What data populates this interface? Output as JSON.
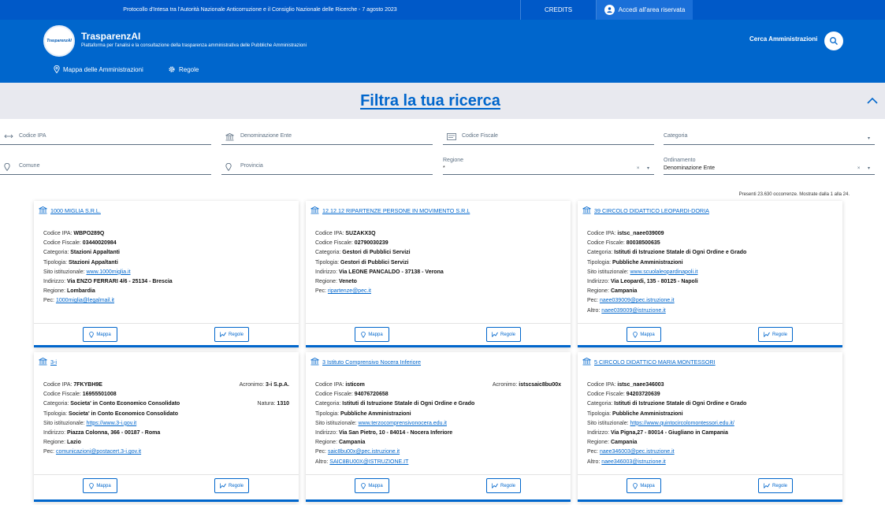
{
  "topbar": {
    "protocol": "Protocollo d'Intesa tra l'Autorità Nazionale Anticorruzione e il Consiglio Nazionale delle Ricerche - 7 agosto 2023",
    "credits": "CREDITS",
    "login": "Accedi all'area riservata"
  },
  "header": {
    "logo_text": "TrasparenzAI",
    "title": "TrasparenzAI",
    "subtitle": "Piattaforma per l'analisi e la consultazione della trasparenza amministrativa delle Pubbliche Amministrazioni",
    "search_label": "Cerca Amministrazioni",
    "nav": {
      "mappa": "Mappa delle Amministrazioni",
      "regole": "Regole"
    }
  },
  "filter": {
    "title": "Filtra la tua ricerca",
    "codice_ipa": "Codice IPA",
    "denominazione": "Denominazione Ente",
    "codice_fiscale": "Codice Fiscale",
    "categoria": "Categoria",
    "comune": "Comune",
    "provincia": "Provincia",
    "regione_label": "Regione",
    "regione_value": "*",
    "ordinamento_label": "Ordinamento",
    "ordinamento_value": "Denominazione Ente"
  },
  "results_count": "Presenti 23.630 occorrenze. Mostrate dalla 1 alla 24.",
  "labels": {
    "codice_ipa": "Codice IPA: ",
    "codice_fiscale": "Codice Fiscale: ",
    "categoria": "Categoria: ",
    "tipologia": "Tipologia: ",
    "sito": "Sito istituzionale: ",
    "indirizzo": "Indirizzo: ",
    "regione": "Regione: ",
    "pec": "Pec: ",
    "altro": "Altro: ",
    "acronimo": "Acronimo: ",
    "natura": "Natura: ",
    "mappa_btn": "Mappa",
    "regole_btn": "Regole"
  },
  "cards": [
    {
      "title": "1000 MIGLIA S.R.L.",
      "codice_ipa": "WBPO289Q",
      "codice_fiscale": "03440020984",
      "categoria": "Stazioni Appaltanti",
      "tipologia": "Stazioni Appaltanti",
      "sito": "www.1000miglia.it",
      "indirizzo": "Via ENZO FERRARI 4/6 - 25134 - Brescia",
      "regione": "Lombardia",
      "pec": "1000miglia@legalmail.it"
    },
    {
      "title": "12.12.12 RIPARTENZE PERSONE IN MOVIMENTO S.R.L",
      "codice_ipa": "SUZAKX3Q",
      "codice_fiscale": "02790030239",
      "categoria": "Gestori di Pubblici Servizi",
      "tipologia": "Gestori di Pubblici Servizi",
      "indirizzo": "Via LEONE PANCALDO - 37138 - Verona",
      "regione": "Veneto",
      "pec": "ripartenze@pec.it"
    },
    {
      "title": "39 CIRCOLO DIDATTICO LEOPARDI-DORIA",
      "codice_ipa": "istsc_naee039009",
      "codice_fiscale": "80038500635",
      "categoria": "Istituti di Istruzione Statale di Ogni Ordine e Grado",
      "tipologia": "Pubbliche Amministrazioni",
      "sito": "www.scuolaleopardinapoli.it",
      "indirizzo": "Via Leopardi, 135 - 80125 - Napoli",
      "regione": "Campania",
      "pec": "naee039009@pec.istruzione.it",
      "altro": "naee039009@istruzione.it"
    },
    {
      "title": "3-i",
      "codice_ipa": "7FKYBH9E",
      "acronimo": "3-i S.p.A.",
      "codice_fiscale": "16955501008",
      "natura": "1310",
      "categoria": "Societa' in Conto Economico Consolidato",
      "tipologia": "Societa' in Conto Economico Consolidato",
      "sito": "https://www.3-i.gov.it",
      "indirizzo": "Piazza Colonna, 366 - 00187 - Roma",
      "regione": "Lazio",
      "pec": "comunicazioni@postacert.3-i.gov.it"
    },
    {
      "title": "3 Istituto Comprensivo Nocera Inferiore",
      "codice_ipa": "isticom",
      "acronimo": "istscsaic8bu00x",
      "codice_fiscale": "94076720658",
      "categoria": "Istituti di Istruzione Statale di Ogni Ordine e Grado",
      "tipologia": "Pubbliche Amministrazioni",
      "sito": "www.terzocomprensivonocera.edu.it",
      "indirizzo": "Via San Pietro, 10 - 84014 - Nocera Inferiore",
      "regione": "Campania",
      "pec": "saic8bu00x@pec.istruzione.it",
      "altro": "SAIC8BU00X@ISTRUZIONE.IT"
    },
    {
      "title": "5 CIRCOLO DIDATTICO MARIA MONTESSORI",
      "codice_ipa": "istsc_naee346003",
      "codice_fiscale": "94203720639",
      "categoria": "Istituti di Istruzione Statale di Ogni Ordine e Grado",
      "tipologia": "Pubbliche Amministrazioni",
      "sito": "https://www.quintocircolomontessori.edu.it/",
      "indirizzo": "Via Pigna,27 - 80014 - Giugliano in Campania",
      "regione": "Campania",
      "pec": "naee346003@pec.istruzione.it",
      "altro": "naee346003@istruzione.it"
    }
  ]
}
